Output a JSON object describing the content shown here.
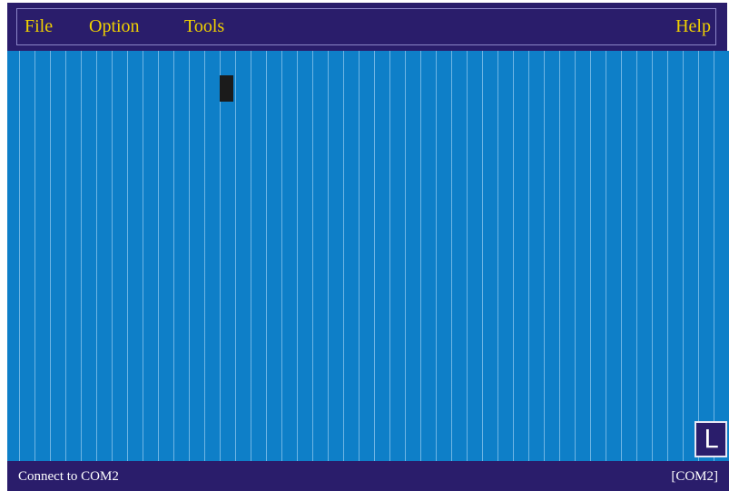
{
  "menubar": {
    "items": [
      {
        "label": "File"
      },
      {
        "label": "Option"
      },
      {
        "label": "Tools"
      }
    ],
    "help_label": "Help"
  },
  "terminal": {
    "mode_indicator": "L"
  },
  "statusbar": {
    "message": "Connect to COM2",
    "port": "[COM2]"
  },
  "colors": {
    "menubar_bg": "#2a1d6b",
    "menu_text": "#f0d000",
    "terminal_bg": "#0e7fc8",
    "cursor": "#1b1b1b",
    "status_text": "#ffffff"
  }
}
